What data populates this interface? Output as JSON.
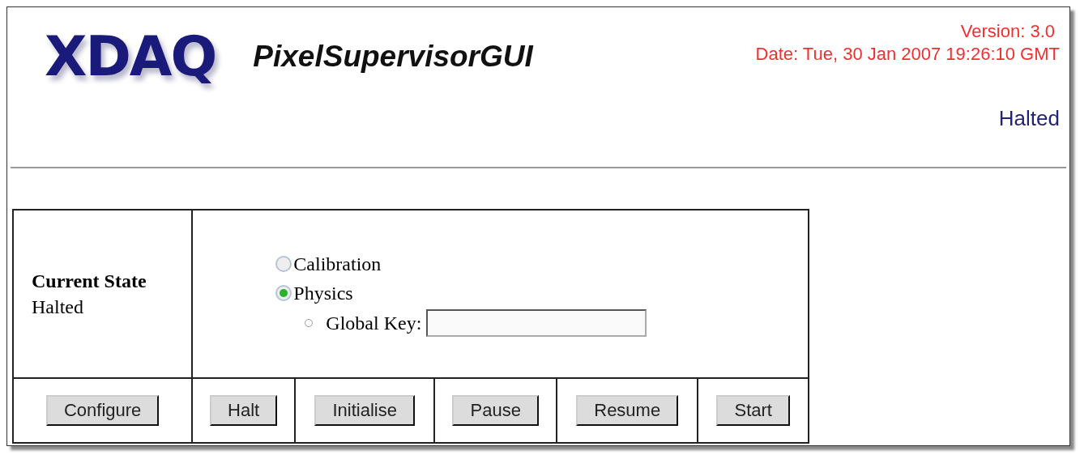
{
  "header": {
    "logo": "XDAQ",
    "title": "PixelSupervisorGUI",
    "version": "Version: 3.0",
    "date": "Date: Tue, 30 Jan 2007 19:26:10 GMT",
    "state": "Halted"
  },
  "state_panel": {
    "label": "Current State",
    "value": "Halted"
  },
  "modes": [
    {
      "label": "Calibration",
      "selected": false
    },
    {
      "label": "Physics",
      "selected": true
    }
  ],
  "global_key": {
    "label": "Global Key:"
  },
  "buttons": [
    "Configure",
    "Halt",
    "Initialise",
    "Pause",
    "Resume",
    "Start"
  ]
}
